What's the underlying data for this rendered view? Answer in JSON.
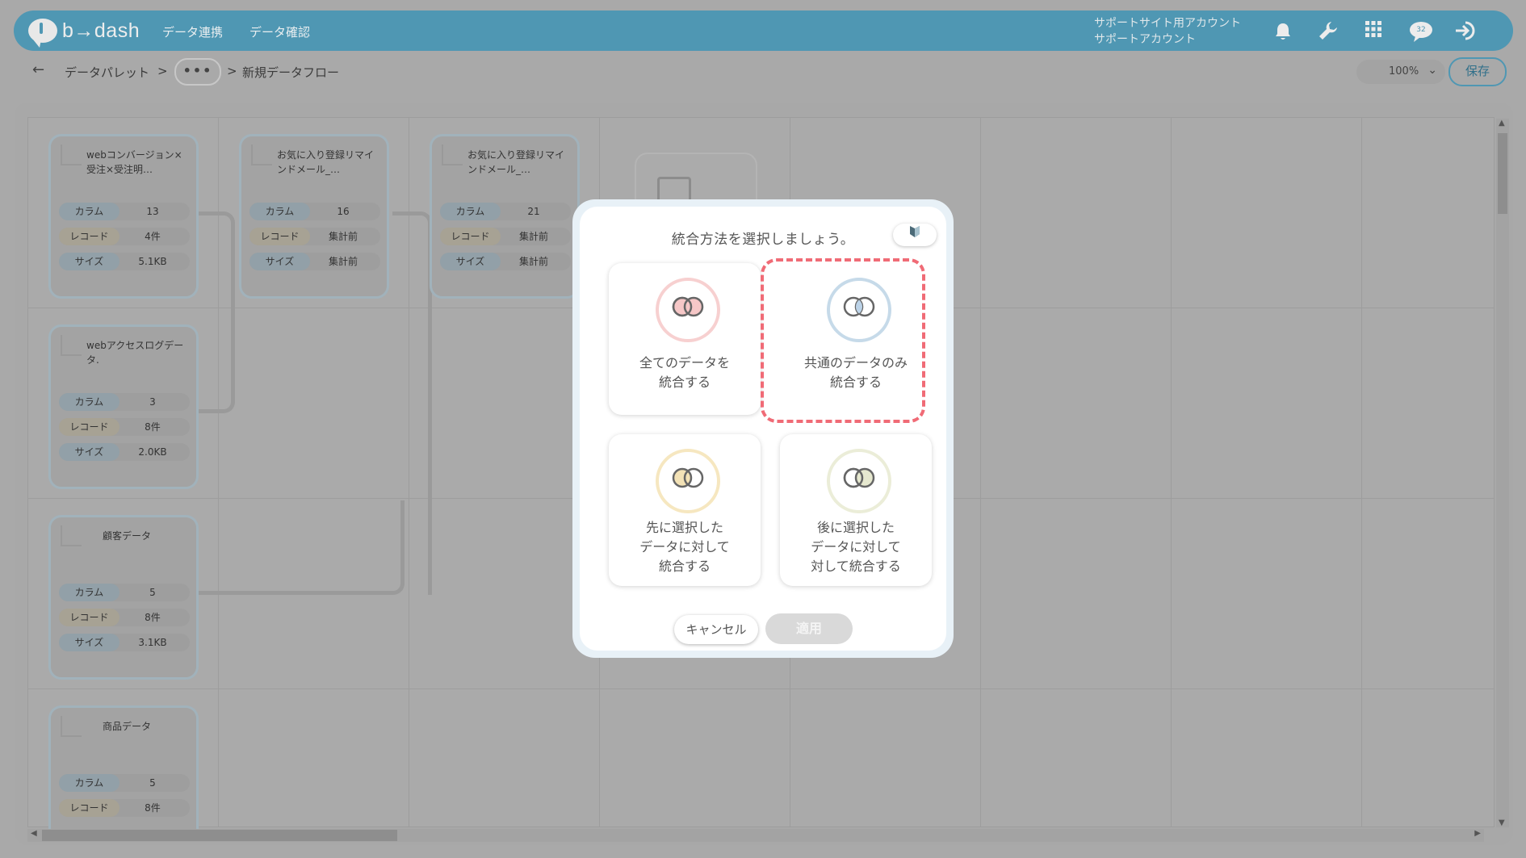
{
  "header": {
    "logo_text": "b→dash",
    "nav": [
      "データ連携",
      "データ確認"
    ],
    "account_line1": "サポートサイト用アカウント",
    "account_line2": "サポートアカウント",
    "badge": "32"
  },
  "toolbar": {
    "breadcrumb_root": "データパレット",
    "separator": ">",
    "ellipsis": "•••",
    "breadcrumb_current": "新規データフロー",
    "zoom": "100%",
    "save_label": "保存"
  },
  "nodes": [
    {
      "title": "webコンバージョン×受注×受注明…",
      "rows": [
        {
          "label": "カラム",
          "value": "13"
        },
        {
          "label": "レコード",
          "value": "4件"
        },
        {
          "label": "サイズ",
          "value": "5.1KB"
        }
      ]
    },
    {
      "title": "お気に入り登録リマインドメール_…",
      "rows": [
        {
          "label": "カラム",
          "value": "16"
        },
        {
          "label": "レコード",
          "value": "集計前"
        },
        {
          "label": "サイズ",
          "value": "集計前"
        }
      ]
    },
    {
      "title": "お気に入り登録リマインドメール_…",
      "rows": [
        {
          "label": "カラム",
          "value": "21"
        },
        {
          "label": "レコード",
          "value": "集計前"
        },
        {
          "label": "サイズ",
          "value": "集計前"
        }
      ]
    },
    {
      "title": "webアクセスログデータ.",
      "rows": [
        {
          "label": "カラム",
          "value": "3"
        },
        {
          "label": "レコード",
          "value": "8件"
        },
        {
          "label": "サイズ",
          "value": "2.0KB"
        }
      ]
    },
    {
      "title": "顧客データ",
      "rows": [
        {
          "label": "カラム",
          "value": "5"
        },
        {
          "label": "レコード",
          "value": "8件"
        },
        {
          "label": "サイズ",
          "value": "3.1KB"
        }
      ]
    },
    {
      "title": "商品データ",
      "rows": [
        {
          "label": "カラム",
          "value": "5"
        },
        {
          "label": "レコード",
          "value": "8件"
        }
      ]
    }
  ],
  "modal": {
    "title": "統合方法を選択しましょう。",
    "options": [
      {
        "label_line1": "全てのデータを",
        "label_line2": "統合する",
        "color": "#f5c4c4"
      },
      {
        "label_line1": "共通のデータのみ",
        "label_line2": "統合する",
        "color": "#bcd3e8",
        "selected": true
      },
      {
        "label_line1": "先に選択した",
        "label_line2": "データに対して",
        "label_line3": "統合する",
        "color": "#f3e2b6"
      },
      {
        "label_line1": "後に選択した",
        "label_line2": "データに対して",
        "label_line3": "対して統合する",
        "color": "#e6e8cf"
      }
    ],
    "cancel_label": "キャンセル",
    "apply_label": "適用"
  },
  "colors": {
    "brand": "#4f97b3",
    "highlight_dash": "#f06b76"
  }
}
